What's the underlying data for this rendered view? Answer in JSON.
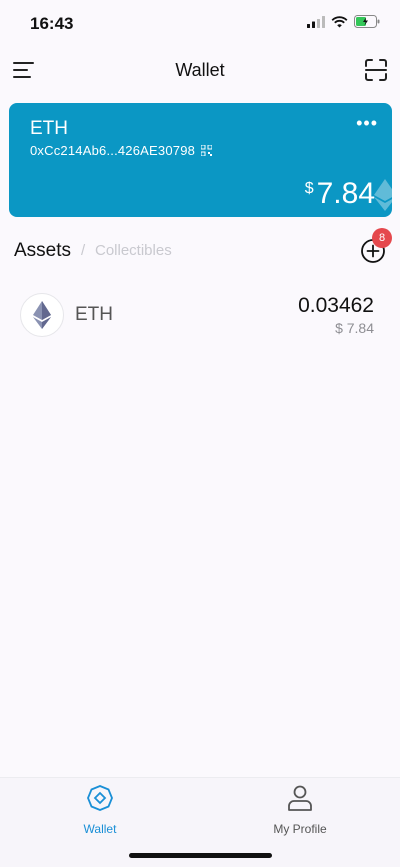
{
  "status_bar": {
    "time": "16:43",
    "icons": [
      "cellular-signal-icon",
      "wifi-icon",
      "battery-charging-icon"
    ]
  },
  "header": {
    "title": "Wallet",
    "left_icon": "menu-icon",
    "right_icon": "scan-icon"
  },
  "account_card": {
    "token": "ETH",
    "address": "0xCc214Ab6...426AE30798",
    "currency_symbol": "$",
    "balance": "7.84",
    "background_color": "#0b97c4"
  },
  "assets_section": {
    "tabs": [
      {
        "label": "Assets",
        "active": true
      },
      {
        "label": "Collectibles",
        "active": false
      }
    ],
    "separator": "/",
    "notification_count": "8"
  },
  "tokens": [
    {
      "symbol": "ETH",
      "balance": "0.03462",
      "fiat_value": "$ 7.84",
      "icon": "ethereum-icon"
    }
  ],
  "bottom_nav": {
    "items": [
      {
        "label": "Wallet",
        "icon": "wallet-icon",
        "active": true
      },
      {
        "label": "My Profile",
        "icon": "profile-icon",
        "active": false
      }
    ],
    "active_color": "#1a8fd6"
  }
}
